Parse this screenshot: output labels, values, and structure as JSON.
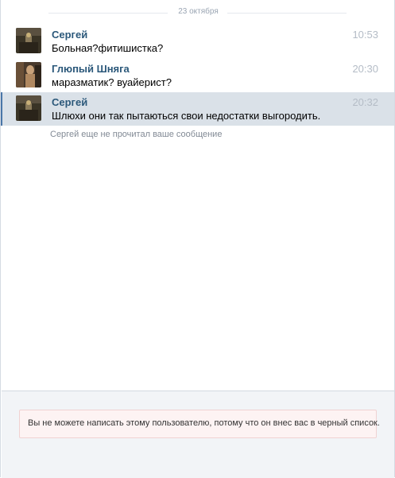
{
  "date_separator": "23 октября",
  "messages": [
    {
      "author": "Сергей",
      "time": "10:53",
      "text": "Больная?фитишистка?",
      "avatar": "avatar-dark-room",
      "selected": false
    },
    {
      "author": "Глюпый Шняга",
      "time": "20:30",
      "text": "маразматик? вуайерист?",
      "avatar": "avatar-figure",
      "selected": false
    },
    {
      "author": "Сергей",
      "time": "20:32",
      "text": "Шлюхи они так пытаються свои недостатки выгородить.",
      "avatar": "avatar-dark-room",
      "selected": true
    }
  ],
  "unread_notice": "Сергей еще не прочитал ваше сообщение",
  "blocked_notice": "Вы не можете написать этому пользователю, потому что он внес вас в черный список.",
  "colors": {
    "author": "#2b587a",
    "time": "#b4bcc6",
    "selected_row": "#dae1e8",
    "blocked_bg": "#fdf3f3",
    "blocked_border": "#f0d2d2"
  }
}
